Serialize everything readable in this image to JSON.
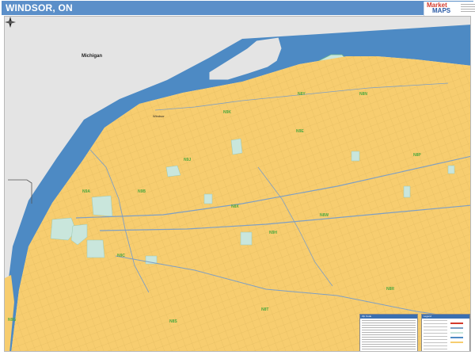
{
  "header": {
    "title": "WINDSOR, ON",
    "logo_top": "Market",
    "logo_bottom": "MAPS"
  },
  "map": {
    "state_label": "Michigan",
    "place_label": "Windsor",
    "zip_labels": [
      "N9G",
      "N8S",
      "N8T",
      "N8R",
      "N8W",
      "N8X",
      "N8P",
      "N8N",
      "N9B",
      "N9A",
      "N9C",
      "N9H",
      "N9E",
      "N9J",
      "N9K",
      "N8Y"
    ],
    "colors": {
      "water": "#4d8ac4",
      "land": "#f7cd6f",
      "other_land": "#e4e4e4",
      "park": "#c9e6dc",
      "road": "#7f9fc2",
      "zip": "#4ea83e",
      "header": "#5b8fc9"
    }
  },
  "legend": {
    "zip_panel_title": "Zip Code",
    "legend_panel_title": "Legend"
  },
  "icons": {
    "compass": "north-arrow-icon"
  }
}
